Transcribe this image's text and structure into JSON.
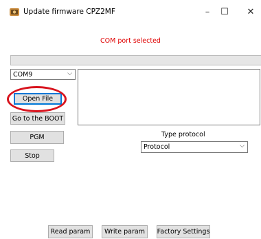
{
  "window": {
    "title": "Update firmware CPZ2MF",
    "minimize_symbol": "–",
    "maximize_symbol": "☐",
    "close_symbol": "✕"
  },
  "status": {
    "text": "COM port selected",
    "color": "#e00000"
  },
  "port_select": {
    "value": "COM9"
  },
  "buttons": {
    "open_file": "Open File",
    "go_to_boot": "Go to the BOOT",
    "pgm": "PGM",
    "stop": "Stop",
    "read_param": "Read param",
    "write_param": "Write param",
    "factory_settings": "Factory Settings"
  },
  "protocol": {
    "label": "Type protocol",
    "value": "Protocol"
  },
  "icons": {
    "app": "app-icon",
    "dropdown": "chevron-down-icon"
  },
  "annotation": {
    "color": "#d8141e"
  }
}
